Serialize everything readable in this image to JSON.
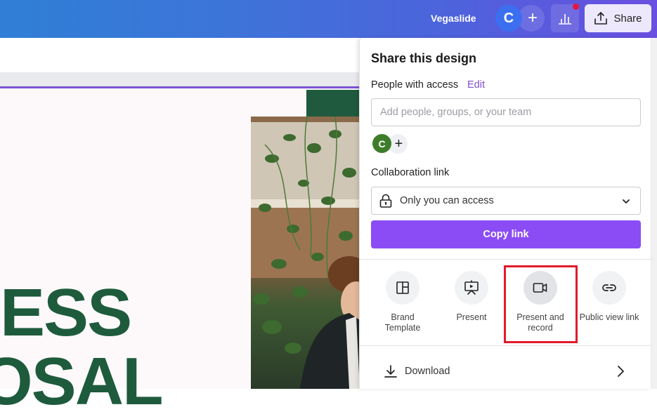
{
  "topbar": {
    "document_title": "Vegaslide",
    "user_avatar_initial": "C",
    "add_collaborator_symbol": "+",
    "insights_icon": "bar-chart-icon",
    "share_label": "Share",
    "share_icon": "upload-icon"
  },
  "canvas": {
    "headline_line1": "ESS",
    "headline_line2": "OSAL",
    "brand_color": "#1e5b3d",
    "selection_color": "#7b53d6"
  },
  "share_panel": {
    "title": "Share this design",
    "people_with_access_label": "People with access",
    "edit_link": "Edit",
    "people_input": {
      "value": "",
      "placeholder": "Add people, groups, or your team"
    },
    "members": [
      {
        "initial": "C",
        "color": "#3d7d2a"
      }
    ],
    "add_member_symbol": "+",
    "collaboration_link_label": "Collaboration link",
    "access_select": {
      "icon": "lock-icon",
      "selected": "Only you can access"
    },
    "copy_link_label": "Copy link",
    "copy_link_color": "#8b4cf6",
    "actions": [
      {
        "label": "Brand\nTemplate",
        "icon": "brand-template-icon"
      },
      {
        "label": "Present",
        "icon": "present-icon"
      },
      {
        "label": "Present and\nrecord",
        "icon": "video-camera-icon",
        "highlighted": true
      },
      {
        "label": "Public view link",
        "icon": "link-icon"
      }
    ],
    "download_label": "Download",
    "highlight_color": "#e01b2b"
  }
}
